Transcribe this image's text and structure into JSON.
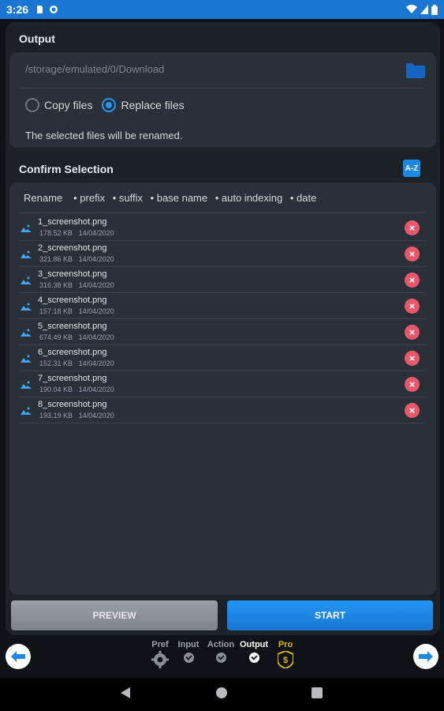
{
  "status_bar": {
    "time": "3:26"
  },
  "output": {
    "title": "Output",
    "path_placeholder": "/storage/emulated/0/Download",
    "copy_label": "Copy files",
    "replace_label": "Replace files",
    "selected_mode": "replace",
    "note": "The selected files will be renamed."
  },
  "selection": {
    "title": "Confirm Selection",
    "sort_icon": "A-Z",
    "rename_label": "Rename",
    "rename_options": [
      "• prefix",
      "• suffix",
      "• base name",
      "• auto indexing",
      "• date"
    ],
    "files": [
      {
        "name": "1_screenshot.png",
        "size": "178.52 KB",
        "date": "14/04/2020"
      },
      {
        "name": "2_screenshot.png",
        "size": "321.86 KB",
        "date": "14/04/2020"
      },
      {
        "name": "3_screenshot.png",
        "size": "316.38 KB",
        "date": "14/04/2020"
      },
      {
        "name": "4_screenshot.png",
        "size": "157.18 KB",
        "date": "14/04/2020"
      },
      {
        "name": "5_screenshot.png",
        "size": "674.49 KB",
        "date": "14/04/2020"
      },
      {
        "name": "6_screenshot.png",
        "size": "152.31 KB",
        "date": "14/04/2020"
      },
      {
        "name": "7_screenshot.png",
        "size": "190.04 KB",
        "date": "14/04/2020"
      },
      {
        "name": "8_screenshot.png",
        "size": "193.19 KB",
        "date": "14/04/2020"
      }
    ]
  },
  "buttons": {
    "preview": "PREVIEW",
    "start": "START"
  },
  "steps": [
    {
      "label": "Pref",
      "icon": "gear-icon"
    },
    {
      "label": "Input",
      "icon": "check-icon"
    },
    {
      "label": "Action",
      "icon": "check-icon"
    },
    {
      "label": "Output",
      "icon": "check-icon",
      "current": true
    },
    {
      "label": "Pro",
      "icon": "dollar-shield-icon"
    }
  ],
  "colors": {
    "accent": "#2196f3",
    "danger": "#e9576a",
    "pro": "#d8b900"
  }
}
